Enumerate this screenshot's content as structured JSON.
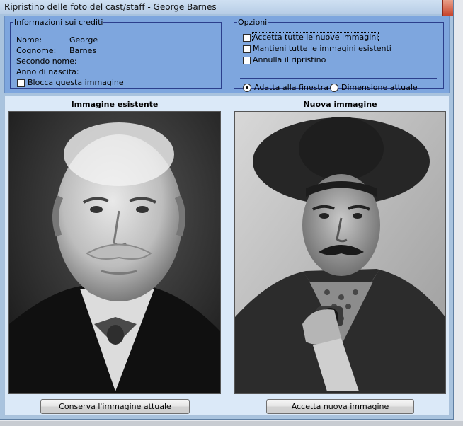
{
  "window": {
    "title": "Ripristino delle foto del cast/staff - George Barnes"
  },
  "info": {
    "legend": "Informazioni sui crediti",
    "rows": [
      {
        "label": "Nome:",
        "value": "George"
      },
      {
        "label": "Cognome:",
        "value": "Barnes"
      },
      {
        "label": "Secondo nome:",
        "value": ""
      },
      {
        "label": "Anno di nascita:",
        "value": ""
      }
    ],
    "lock_label": "Blocca questa immagine",
    "lock_checked": false
  },
  "options": {
    "legend": "Opzioni",
    "checkboxes": [
      {
        "label": "Accetta tutte le nuove immagini",
        "checked": false
      },
      {
        "label": "Mantieni tutte le immagini esistenti",
        "checked": false
      },
      {
        "label": "Annulla il ripristino",
        "checked": false
      }
    ],
    "radios": [
      {
        "label": "Adatta alla finestra",
        "selected": true
      },
      {
        "label": "Dimensione attuale",
        "selected": false
      }
    ]
  },
  "existing": {
    "heading": "Immagine esistente",
    "button_first": "C",
    "button_rest": "onserva l'immagine attuale"
  },
  "incoming": {
    "heading": "Nuova immagine",
    "button_first": "A",
    "button_rest": "ccetta nuova immagine"
  }
}
